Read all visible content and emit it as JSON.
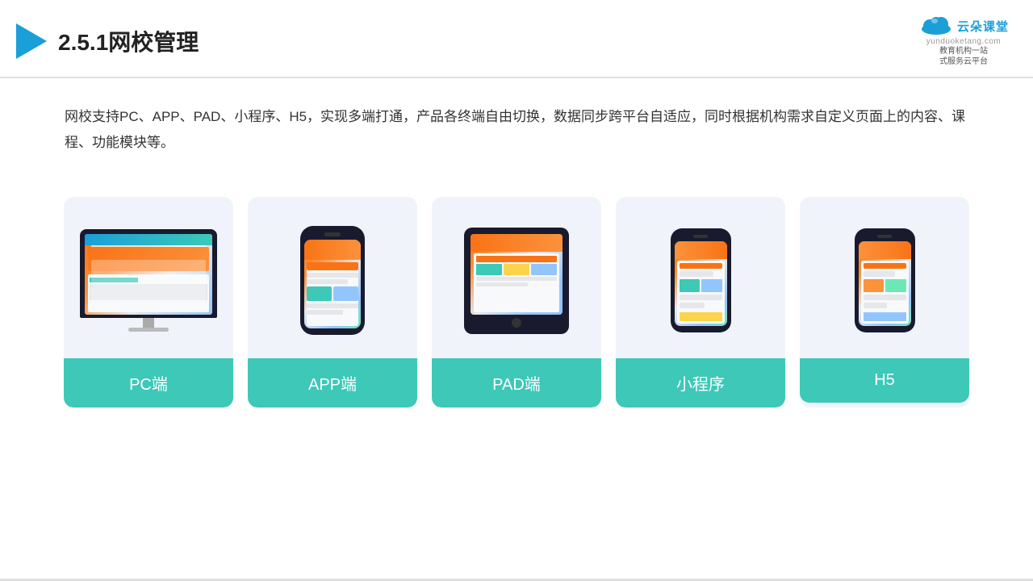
{
  "header": {
    "title": "2.5.1网校管理",
    "logo": {
      "name_cn": "云朵课堂",
      "name_en": "yunduoketang.com",
      "slogan_line1": "教育机构一站",
      "slogan_line2": "式服务云平台"
    }
  },
  "description": {
    "text": "网校支持PC、APP、PAD、小程序、H5，实现多端打通，产品各终端自由切换，数据同步跨平台自适应，同时根据机构需求自定义页面上的内容、课程、功能模块等。"
  },
  "cards": [
    {
      "id": "pc",
      "label": "PC端"
    },
    {
      "id": "app",
      "label": "APP端"
    },
    {
      "id": "pad",
      "label": "PAD端"
    },
    {
      "id": "miniprogram",
      "label": "小程序"
    },
    {
      "id": "h5",
      "label": "H5"
    }
  ],
  "colors": {
    "teal": "#3dc8b8",
    "blue": "#1a9fd8",
    "accent_orange": "#f97316"
  }
}
